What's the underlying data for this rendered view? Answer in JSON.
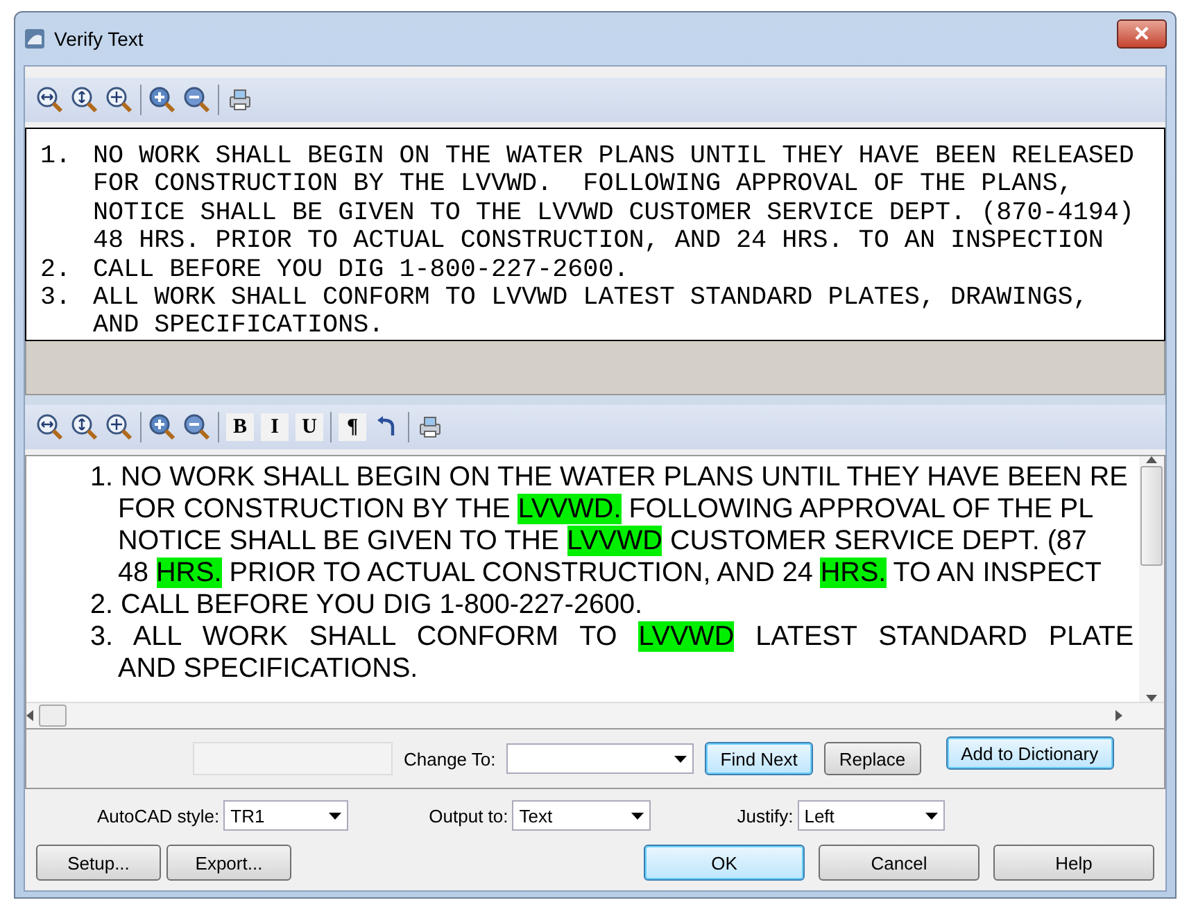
{
  "window": {
    "title": "Verify Text"
  },
  "preview_toolbar": [
    {
      "kind": "zoom-width"
    },
    {
      "kind": "zoom-height"
    },
    {
      "kind": "zoom-extents"
    },
    {
      "kind": "sep"
    },
    {
      "kind": "zoom-in"
    },
    {
      "kind": "zoom-out"
    },
    {
      "kind": "sep"
    },
    {
      "kind": "print"
    }
  ],
  "preview": [
    {
      "number": "1.",
      "lines": [
        "NO WORK SHALL BEGIN ON THE WATER PLANS UNTIL THEY HAVE BEEN RELEASED",
        "FOR CONSTRUCTION BY THE LVVWD.  FOLLOWING APPROVAL OF THE PLANS,",
        "NOTICE SHALL BE GIVEN TO THE LVVWD CUSTOMER SERVICE DEPT. (870-4194)",
        "48 HRS. PRIOR TO ACTUAL CONSTRUCTION, AND 24 HRS. TO AN INSPECTION"
      ]
    },
    {
      "number": "2.",
      "lines": [
        "CALL BEFORE YOU DIG 1-800-227-2600."
      ]
    },
    {
      "number": "3.",
      "lines": [
        "ALL WORK SHALL CONFORM TO LVVWD LATEST STANDARD PLATES, DRAWINGS,",
        "AND SPECIFICATIONS."
      ]
    }
  ],
  "editor_toolbar": [
    {
      "kind": "zoom-width"
    },
    {
      "kind": "zoom-height"
    },
    {
      "kind": "zoom-extents"
    },
    {
      "kind": "sep"
    },
    {
      "kind": "zoom-in"
    },
    {
      "kind": "zoom-out"
    },
    {
      "kind": "sep"
    },
    {
      "kind": "text",
      "label": "B"
    },
    {
      "kind": "text",
      "label": "I"
    },
    {
      "kind": "text",
      "label": "U"
    },
    {
      "kind": "sep"
    },
    {
      "kind": "text",
      "label": "¶"
    },
    {
      "kind": "undo"
    },
    {
      "kind": "sep"
    },
    {
      "kind": "print"
    }
  ],
  "editor": [
    {
      "indent": false,
      "justify": false,
      "segments": [
        {
          "text": "1. NO WORK SHALL BEGIN ON THE WATER PLANS UNTIL THEY HAVE BEEN RE",
          "flagged": false
        }
      ]
    },
    {
      "indent": true,
      "justify": false,
      "segments": [
        {
          "text": "FOR CONSTRUCTION BY THE ",
          "flagged": false
        },
        {
          "text": "LVVWD.",
          "flagged": true
        },
        {
          "text": " FOLLOWING APPROVAL OF THE PL",
          "flagged": false
        }
      ]
    },
    {
      "indent": true,
      "justify": false,
      "segments": [
        {
          "text": "NOTICE SHALL BE GIVEN TO THE ",
          "flagged": false
        },
        {
          "text": "LVVWD",
          "flagged": true
        },
        {
          "text": " CUSTOMER SERVICE DEPT. (87",
          "flagged": false
        }
      ]
    },
    {
      "indent": true,
      "justify": false,
      "segments": [
        {
          "text": "48 ",
          "flagged": false
        },
        {
          "text": "HRS.",
          "flagged": true
        },
        {
          "text": " PRIOR TO ACTUAL CONSTRUCTION, AND 24 ",
          "flagged": false
        },
        {
          "text": "HRS.",
          "flagged": true
        },
        {
          "text": " TO AN INSPECT",
          "flagged": false
        }
      ]
    },
    {
      "indent": false,
      "justify": false,
      "segments": [
        {
          "text": "2. CALL BEFORE YOU DIG 1-800-227-2600.",
          "flagged": false
        }
      ]
    },
    {
      "indent": false,
      "justify": true,
      "segments": [
        {
          "text": "3. ALL WORK SHALL CONFORM TO ",
          "flagged": false
        },
        {
          "text": "LVVWD",
          "flagged": true
        },
        {
          "text": " LATEST STANDARD PLATE",
          "flagged": false
        }
      ]
    },
    {
      "indent": true,
      "justify": false,
      "segments": [
        {
          "text": "AND SPECIFICATIONS.",
          "flagged": false
        }
      ]
    }
  ],
  "change_row": {
    "change_to_label": "Change To:",
    "buttons": [
      {
        "label": "Find Next",
        "default": true
      },
      {
        "label": "Replace",
        "default": false
      },
      {
        "label": "Add to Dictionary",
        "default": true
      }
    ]
  },
  "options": [
    {
      "label": "AutoCAD style:",
      "value": "TR1"
    },
    {
      "label": "Output to:",
      "value": "Text"
    },
    {
      "label": "Justify:",
      "value": "Left"
    }
  ],
  "left_buttons": [
    {
      "label": "Setup...",
      "default": false
    },
    {
      "label": "Export...",
      "default": false
    }
  ],
  "right_buttons": [
    {
      "label": "OK",
      "default": true
    },
    {
      "label": "Cancel",
      "default": false
    },
    {
      "label": "Help",
      "default": false
    }
  ]
}
